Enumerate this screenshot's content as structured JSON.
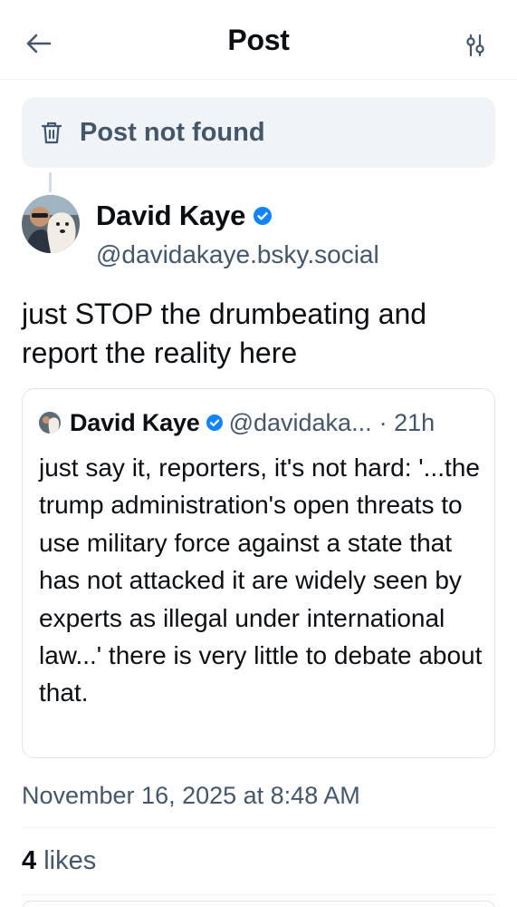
{
  "header": {
    "title": "Post",
    "back_icon": "arrow-left-icon",
    "filter_icon": "sliders-icon"
  },
  "not_found": {
    "label": "Post not found",
    "icon": "trash-icon"
  },
  "post": {
    "author_name": "David Kaye",
    "author_handle": "@davidakaye.bsky.social",
    "text": "just STOP the drumbeating and report the reality here",
    "timestamp": "November 16, 2025 at 8:48 AM",
    "likes_count": "4",
    "likes_label": "likes"
  },
  "quote": {
    "author_name": "David Kaye",
    "author_handle": "@davidaka...",
    "time": "· 21h",
    "text": "just say it, reporters, it's not hard: '...the trump administration's open threats to use military force against a state that has not attacked it are widely seen by experts as illegal under international law...' there is very little to debate about that."
  },
  "colors": {
    "accent": "#1083fe",
    "muted_text": "#42576c",
    "banner_bg": "#f1f4f7",
    "border": "#dfe4ea"
  }
}
